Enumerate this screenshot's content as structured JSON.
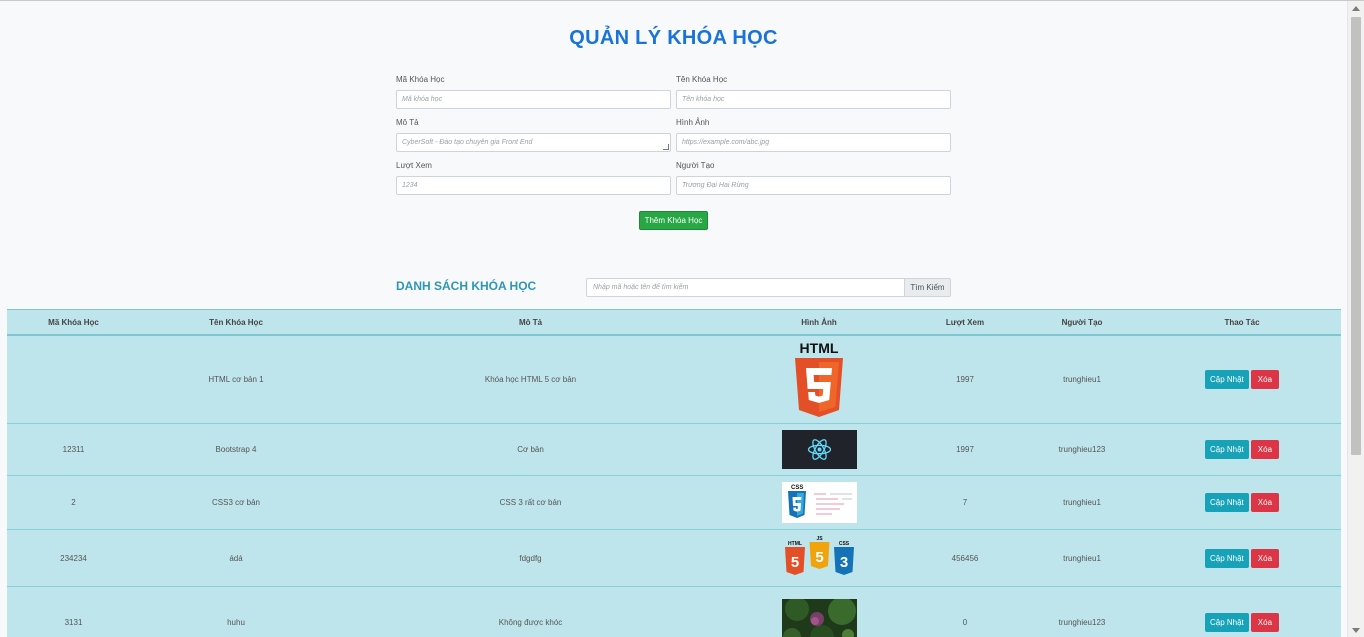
{
  "title": "QUẢN LÝ KHÓA HỌC",
  "form": {
    "ma_label": "Mã Khóa Học",
    "ma_placeholder": "Mã khóa học",
    "ten_label": "Tên Khóa Học",
    "ten_placeholder": "Tên khóa học",
    "mota_label": "Mô Tả",
    "mota_placeholder": "CyberSoft - Đào tạo chuyên gia Front End",
    "hinh_label": "Hình Ảnh",
    "hinh_placeholder": "https://example.com/abc.jpg",
    "luot_label": "Lượt Xem",
    "luot_placeholder": "1234",
    "nguoi_label": "Người Tạo",
    "nguoi_placeholder": "Trương Đại Hai Rừng",
    "add_button": "Thêm Khóa Học"
  },
  "list": {
    "title": "DANH SÁCH KHÓA HỌC",
    "search_placeholder": "Nhập mã hoặc tên để tìm kiếm",
    "search_button": "Tìm Kiếm"
  },
  "table": {
    "headers": [
      "Mã Khóa Học",
      "Tên Khóa Học",
      "Mô Tả",
      "Hình Ảnh",
      "Lượt Xem",
      "Người Tạo",
      "Thao Tác"
    ],
    "update_label": "Cập Nhật",
    "delete_label": "Xóa",
    "rows": [
      {
        "ma": "",
        "ten": "HTML cơ bản 1",
        "mota": "Khóa học HTML 5 cơ bản",
        "image": "html5-logo",
        "luot": "1997",
        "nguoi": "trunghieu1"
      },
      {
        "ma": "12311",
        "ten": "Bootstrap 4",
        "mota": "Cơ bản",
        "image": "react-logo",
        "luot": "1997",
        "nguoi": "trunghieu123"
      },
      {
        "ma": "2",
        "ten": "CSS3 cơ bản",
        "mota": "CSS 3 rất cơ bản",
        "image": "css3-logo",
        "luot": "7",
        "nguoi": "trunghieu1"
      },
      {
        "ma": "234234",
        "ten": "ádá",
        "mota": "fdgdfg",
        "image": "html-js-css-logos",
        "luot": "456456",
        "nguoi": "trunghieu1"
      },
      {
        "ma": "3131",
        "ten": "huhu",
        "mota": "Không được khóc",
        "image": "nature-photo",
        "luot": "0",
        "nguoi": "trunghieu123"
      }
    ]
  },
  "colors": {
    "title": "#1a73d6",
    "add": "#28a745",
    "update": "#17a2b8",
    "delete": "#dc3545",
    "table_bg": "#bee5eb"
  }
}
